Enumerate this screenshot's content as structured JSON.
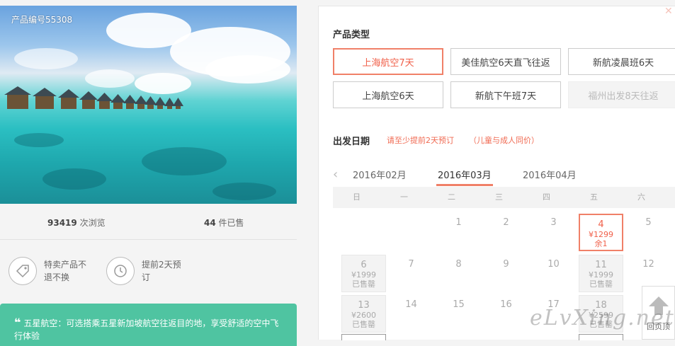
{
  "product": {
    "code_label": "产品编号55308",
    "views_count": "93419",
    "views_label": "次浏览",
    "sold_count": "44",
    "sold_label": "件已售",
    "features": [
      {
        "icon": "tag-icon",
        "label": "特卖产品不退不换"
      },
      {
        "icon": "clock-history-icon",
        "label": "提前2天预订"
      }
    ],
    "note_quote": "❝",
    "note_text": "五星航空：可选搭乘五星新加坡航空往返目的地，享受舒适的空中飞行体验"
  },
  "booking": {
    "type_title": "产品类型",
    "types": [
      {
        "label": "上海航空7天",
        "state": "selected"
      },
      {
        "label": "美佳航空6天直飞往返",
        "state": "normal"
      },
      {
        "label": "新航凌晨班6天",
        "state": "normal"
      },
      {
        "label": "上海航空6天",
        "state": "normal"
      },
      {
        "label": "新航下午班7天",
        "state": "normal"
      },
      {
        "label": "福州出发8天往返",
        "state": "disabled"
      }
    ],
    "date_title": "出发日期",
    "date_hint_1": "请至少提前2天预订",
    "date_hint_2": "（儿童与成人同价）",
    "months": [
      "2016年02月",
      "2016年03月",
      "2016年04月"
    ],
    "active_month_index": 1,
    "weekdays": [
      "日",
      "一",
      "二",
      "三",
      "四",
      "五",
      "六"
    ],
    "days": [
      {
        "day": "1"
      },
      {
        "day": "2"
      },
      {
        "day": "3"
      },
      {
        "day": "4",
        "price": "¥1299",
        "status": "余1",
        "state": "avail"
      },
      {
        "day": "5"
      },
      {
        "day": "6",
        "price": "¥1999",
        "status": "已售罄",
        "state": "sold"
      },
      {
        "day": "7"
      },
      {
        "day": "8"
      },
      {
        "day": "9"
      },
      {
        "day": "10"
      },
      {
        "day": "11",
        "price": "¥1999",
        "status": "已售罄",
        "state": "sold"
      },
      {
        "day": "12"
      },
      {
        "day": "13",
        "price": "¥2600",
        "status": "已售罄",
        "state": "sold"
      },
      {
        "day": "14"
      },
      {
        "day": "15"
      },
      {
        "day": "16"
      },
      {
        "day": "17"
      },
      {
        "day": "18",
        "price": "¥2599",
        "status": "已售罄",
        "state": "sold"
      }
    ]
  },
  "back_to_top": "回页顶",
  "watermark": "eLvXing.net",
  "colors": {
    "accent": "#f08068",
    "green": "#4fc4a1"
  }
}
